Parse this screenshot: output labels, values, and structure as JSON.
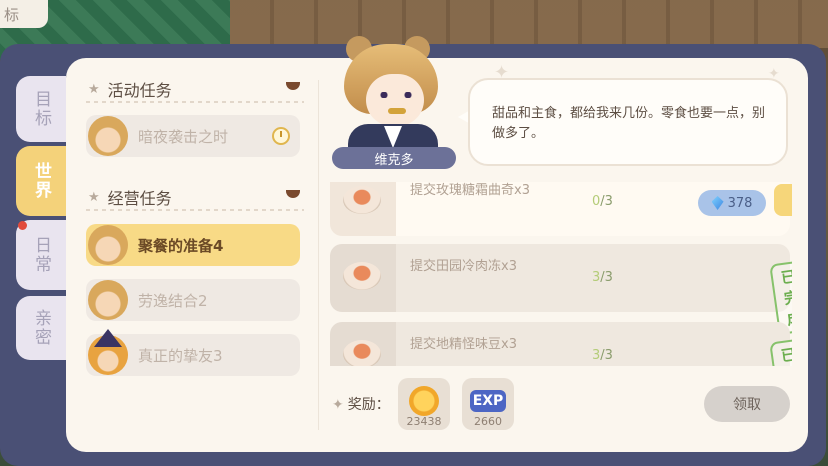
{
  "corner": {
    "label": "标"
  },
  "side_tabs": [
    {
      "label": "目标"
    },
    {
      "label": "世界"
    },
    {
      "label": "日常"
    },
    {
      "label": "亲密"
    }
  ],
  "sections": {
    "event": {
      "title": "活动任务",
      "items": [
        {
          "label": "暗夜袭击之时"
        }
      ]
    },
    "business": {
      "title": "经营任务",
      "items": [
        {
          "label": "聚餐的准备4"
        },
        {
          "label": "劳逸结合2"
        },
        {
          "label": "真正的挚友3"
        }
      ]
    }
  },
  "npc": {
    "name": "维克多",
    "dialogue": "甜品和主食，都给我来几份。零食也要一点，别做多了。"
  },
  "tasks": [
    {
      "name": "提交玫瑰糖霜曲奇x3",
      "current": "0",
      "total": "/3",
      "gem_cost": "378"
    },
    {
      "name": "提交田园冷肉冻x3",
      "current": "3",
      "total": "/3",
      "status": "已完成"
    },
    {
      "name": "提交地精怪味豆x3",
      "current": "3",
      "total": "/3",
      "status": "已完成"
    }
  ],
  "rewards": {
    "label": "奖励：",
    "items": [
      {
        "icon": "coin-icon",
        "amount": "23438"
      },
      {
        "icon": "exp-icon",
        "text": "EXP",
        "amount": "2660"
      }
    ]
  },
  "claim_button": "领取",
  "colors": {
    "frame": "#4a5075",
    "active_tab": "#f4d27a",
    "panel": "#fbf6ee",
    "done_green": "#6cae4f"
  }
}
